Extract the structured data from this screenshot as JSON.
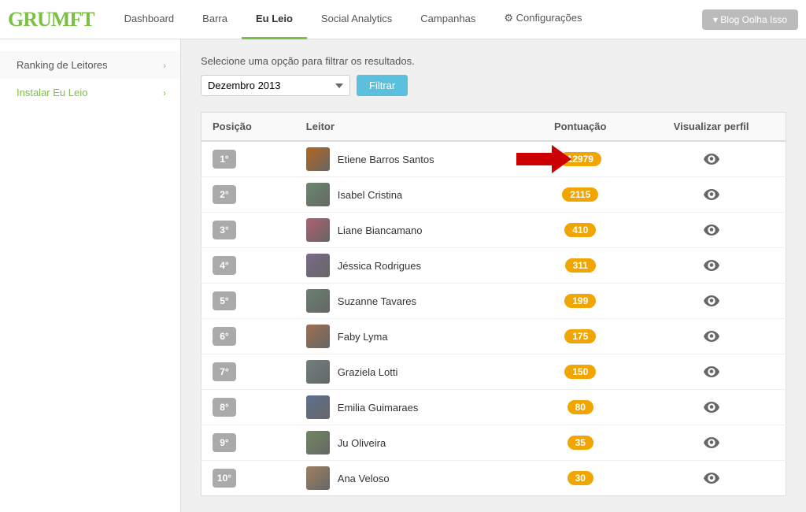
{
  "logo": {
    "text_dark": "GRUM",
    "text_green": "FT"
  },
  "nav": {
    "items": [
      {
        "label": "Dashboard",
        "active": false
      },
      {
        "label": "Barra",
        "active": false
      },
      {
        "label": "Eu Leio",
        "active": true
      },
      {
        "label": "Social Analytics",
        "active": false
      },
      {
        "label": "Campanhas",
        "active": false
      },
      {
        "label": "⚙ Configurações",
        "active": false
      }
    ],
    "blog_button": "▾ Blog Oolha Isso"
  },
  "sidebar": {
    "items": [
      {
        "label": "Ranking de Leitores",
        "active": true,
        "green": false
      },
      {
        "label": "Instalar Eu Leio",
        "active": false,
        "green": true
      }
    ]
  },
  "filter": {
    "label": "Selecione uma opção para filtrar os resultados.",
    "month_value": "Dezembro 2013",
    "button_label": "Filtrar"
  },
  "table": {
    "headers": [
      "Posição",
      "Leitor",
      "Pontuação",
      "Visualizar perfil"
    ],
    "rows": [
      {
        "position": "1°",
        "name": "Etiene Barros Santos",
        "score": "12979",
        "highlighted": true
      },
      {
        "position": "2°",
        "name": "Isabel Cristina",
        "score": "2115",
        "highlighted": false
      },
      {
        "position": "3°",
        "name": "Liane Biancamano",
        "score": "410",
        "highlighted": false
      },
      {
        "position": "4°",
        "name": "Jéssica Rodrigues",
        "score": "311",
        "highlighted": false
      },
      {
        "position": "5°",
        "name": "Suzanne Tavares",
        "score": "199",
        "highlighted": false
      },
      {
        "position": "6°",
        "name": "Faby Lyma",
        "score": "175",
        "highlighted": false
      },
      {
        "position": "7°",
        "name": "Graziela Lotti",
        "score": "150",
        "highlighted": false
      },
      {
        "position": "8°",
        "name": "Emilia Guimaraes",
        "score": "80",
        "highlighted": false
      },
      {
        "position": "9°",
        "name": "Ju Oliveira",
        "score": "35",
        "highlighted": false
      },
      {
        "position": "10°",
        "name": "Ana Veloso",
        "score": "30",
        "highlighted": false
      }
    ]
  }
}
